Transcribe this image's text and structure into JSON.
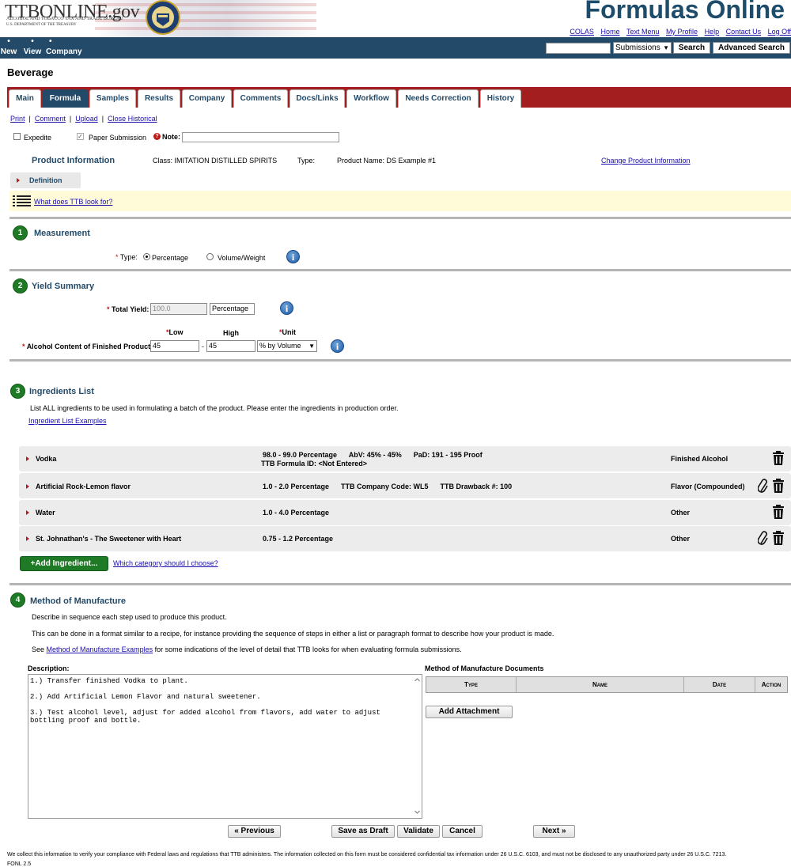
{
  "header": {
    "logo_main": "TTBONLINE.gov",
    "logo_sub1": "ALCOHOL AND TOBACCO TAX AND TRADE BUREAU",
    "logo_sub2": "U.S. DEPARTMENT OF THE TREASURY",
    "app_title": "Formulas Online",
    "links": [
      "COLAS",
      "Home",
      "Text Menu",
      "My Profile",
      "Help",
      "Contact Us",
      "Log Off"
    ]
  },
  "navbar": {
    "items": [
      "New",
      "View",
      "Company"
    ],
    "search_value": "",
    "select_value": "Submissions",
    "search_button": "Search",
    "advanced_search_button": "Advanced Search"
  },
  "page_title": "Beverage",
  "tabs": [
    "Main",
    "Formula",
    "Samples",
    "Results",
    "Company",
    "Comments",
    "Docs/Links",
    "Workflow",
    "Needs Correction",
    "History"
  ],
  "active_tab": "Formula",
  "action_links": [
    "Print",
    "Comment",
    "Upload",
    "Close Historical"
  ],
  "options": {
    "expedite_label": "Expedite",
    "paper_label": "Paper Submission",
    "note_label": "Note:",
    "note_value": ""
  },
  "product_info": {
    "heading": "Product Information",
    "class_text": "Class: IMITATION DISTILLED SPIRITS",
    "type_text": "Type:",
    "product_name_text": "Product Name: DS Example #1",
    "change_link": "Change Product Information",
    "definition_label": "Definition",
    "hint_link": "What does TTB look for?"
  },
  "measurement": {
    "step": "1",
    "title": "Measurement",
    "type_label": "Type:",
    "option_percentage": "Percentage",
    "option_volume": "Volume/Weight",
    "selected": "Percentage"
  },
  "yield": {
    "step": "2",
    "title": "Yield Summary",
    "total_label": "Total Yield:",
    "total_value": "100.0",
    "total_unit": "Percentage",
    "low_header": "Low",
    "high_header": "High",
    "unit_header": "Unit",
    "alcohol_label": "Alcohol Content of Finished Product:",
    "low_value": "45",
    "dash": "-",
    "high_value": "45",
    "unit_value": "% by Volume"
  },
  "ingredients": {
    "step": "3",
    "title": "Ingredients List",
    "instruction": "List ALL ingredients to be used in formulating a batch of the product. Please enter the ingredients in production order.",
    "examples_link": "Ingredient List Examples",
    "rows": [
      {
        "name": "Vodka",
        "detail": "98.0 - 99.0 Percentage      AbV: 45% - 45%      PaD: 191 - 195 Proof",
        "detail2": "TTB Formula ID: <Not Entered>",
        "category": "Finished Alcohol"
      },
      {
        "name": "Artificial Rock-Lemon flavor",
        "detail": "1.0 - 2.0 Percentage      TTB Company Code: WL5      TTB Drawback #: 100",
        "detail2": "",
        "category": "Flavor (Compounded)"
      },
      {
        "name": "Water",
        "detail": "1.0 - 4.0 Percentage",
        "detail2": "",
        "category": "Other"
      },
      {
        "name": "St. Johnathan's - The Sweetener with Heart",
        "detail": "0.75 - 1.2 Percentage",
        "detail2": "",
        "category": "Other"
      }
    ],
    "add_button": "+Add Ingredient...",
    "category_link": "Which category should I choose?"
  },
  "manufacture": {
    "step": "4",
    "title": "Method of Manufacture",
    "line1": "Describe in sequence each step used to produce this product.",
    "line2": "This can be done in a format similar to a recipe, for instance providing the sequence of steps in either a list or paragraph format to describe how your product is made.",
    "line3_pre": "See",
    "line3_link": "Method of Manufacture Examples",
    "line3_post": "for some indications of the level of detail that TTB looks for when evaluating formula submissions.",
    "description_label": "Description:",
    "description_value": "1.) Transfer finished Vodka to plant.\n\n2.) Add Artificial Lemon Flavor and natural sweetener.\n\n3.) Test alcohol level, adjust for added alcohol from flavors, add water to adjust\nbottling proof and bottle.",
    "docs_label": "Method of Manufacture Documents",
    "docs_columns": [
      "Type",
      "Name",
      "Date",
      "Action"
    ],
    "add_attachment": "Add Attachment"
  },
  "buttons": {
    "previous": "« Previous",
    "save_draft": "Save as Draft",
    "validate": "Validate",
    "cancel": "Cancel",
    "next": "Next »"
  },
  "footer": {
    "text": "We collect this information to verify your compliance with Federal laws and regulations that TTB administers. The information collected on this form must be considered confidential tax information under 26 U.S.C. 6103, and must not be disclosed to any unauthorized party under 26 U.S.C. 7213.",
    "code": "FONL 2.5"
  },
  "colors": {
    "navbar": "#234a68",
    "tabbar": "#a31f1f",
    "step_green": "#1f7a26",
    "hint_bg": "#fffbd9"
  }
}
